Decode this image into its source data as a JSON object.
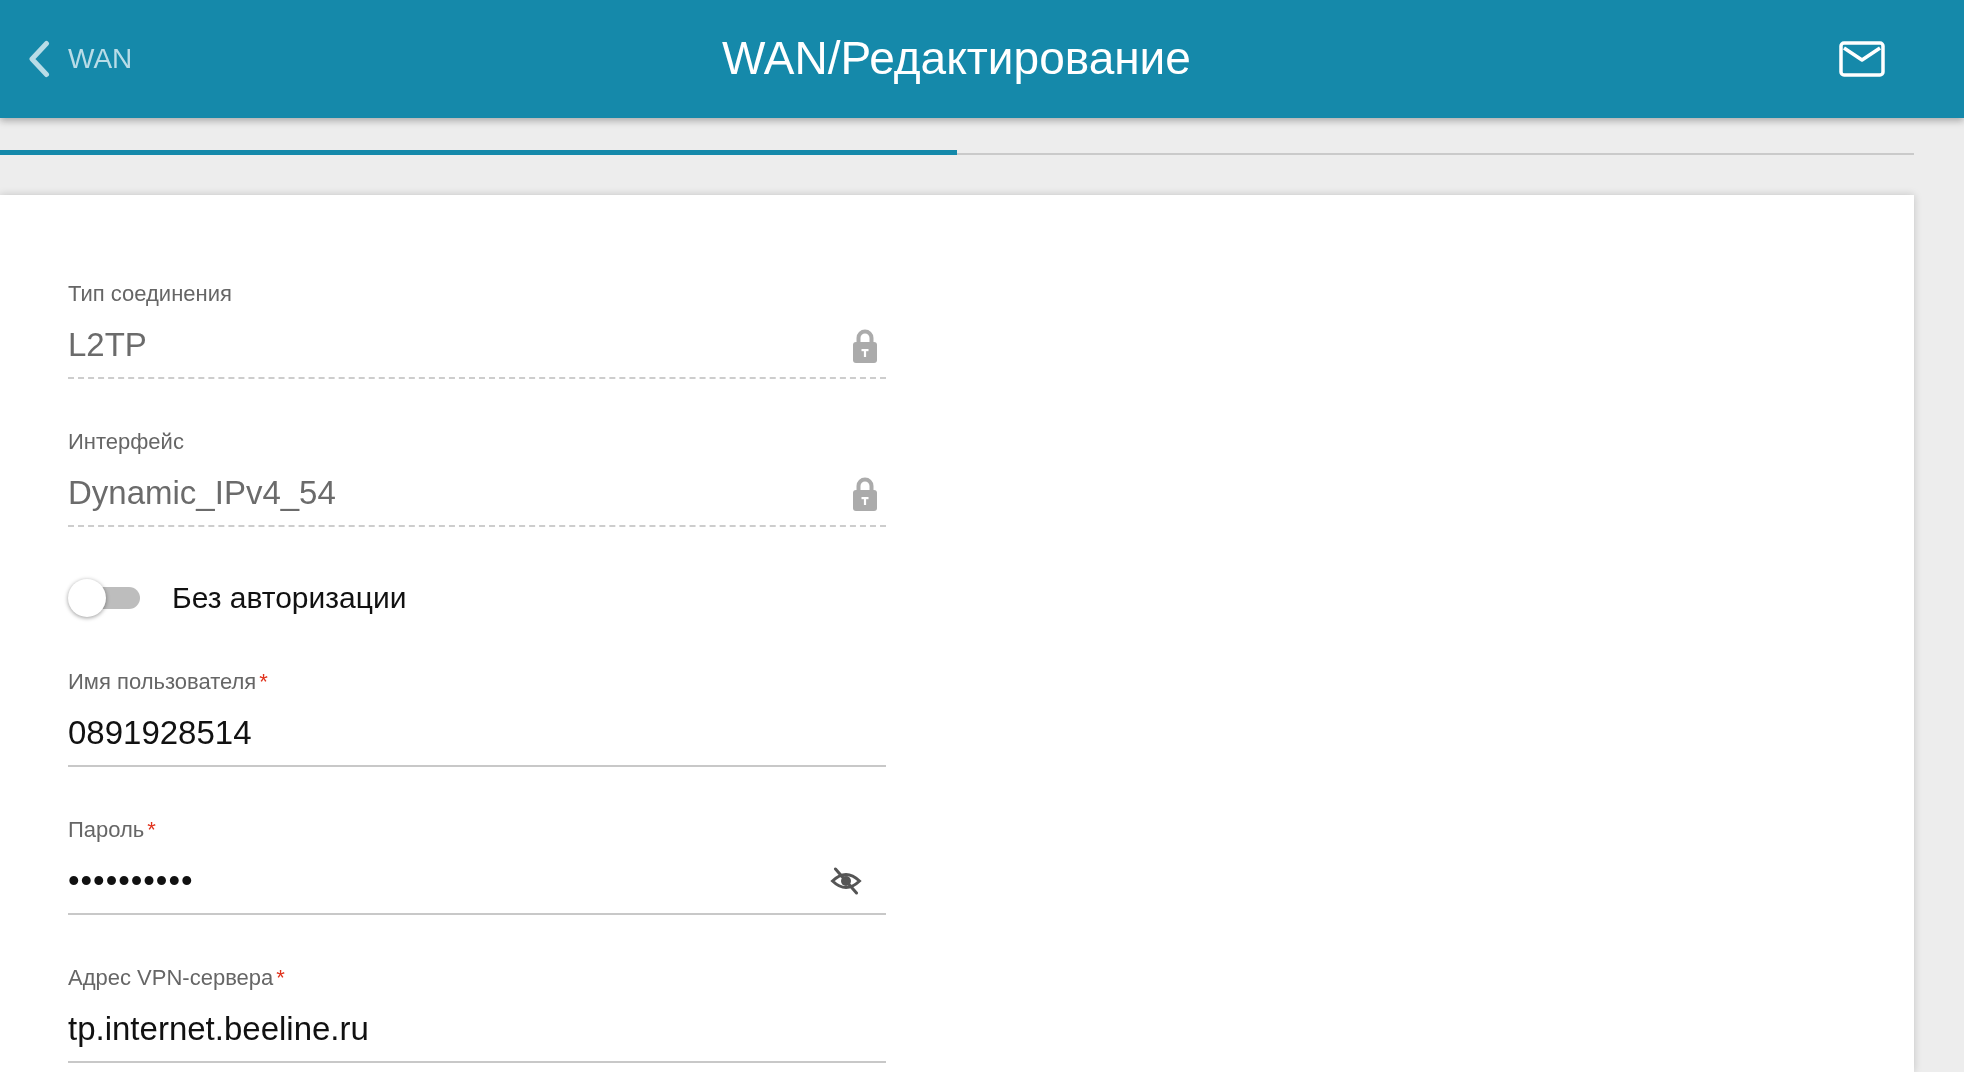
{
  "header": {
    "back_label": "WAN",
    "title": "WAN/Редактирование"
  },
  "tabs": [
    {
      "selected": true
    },
    {
      "selected": false
    }
  ],
  "form": {
    "items": [
      {
        "kind": "text",
        "label": "Тип соединения",
        "value": "L2TP",
        "disabled": true
      },
      {
        "kind": "text",
        "label": "Интерфейс",
        "value": "Dynamic_IPv4_54",
        "disabled": true
      },
      {
        "kind": "switch",
        "label": "Без авторизации",
        "on": false
      },
      {
        "kind": "text",
        "label": "Имя пользователя",
        "required_mark": "*",
        "value": "0891928514",
        "disabled": false
      },
      {
        "kind": "password",
        "label": "Пароль",
        "required_mark": "*",
        "value": "••••••••••",
        "disabled": false
      },
      {
        "kind": "text",
        "label": "Адрес VPN-сервера",
        "required_mark": "*",
        "value": "tp.internet.beeline.ru",
        "disabled": false
      }
    ]
  }
}
